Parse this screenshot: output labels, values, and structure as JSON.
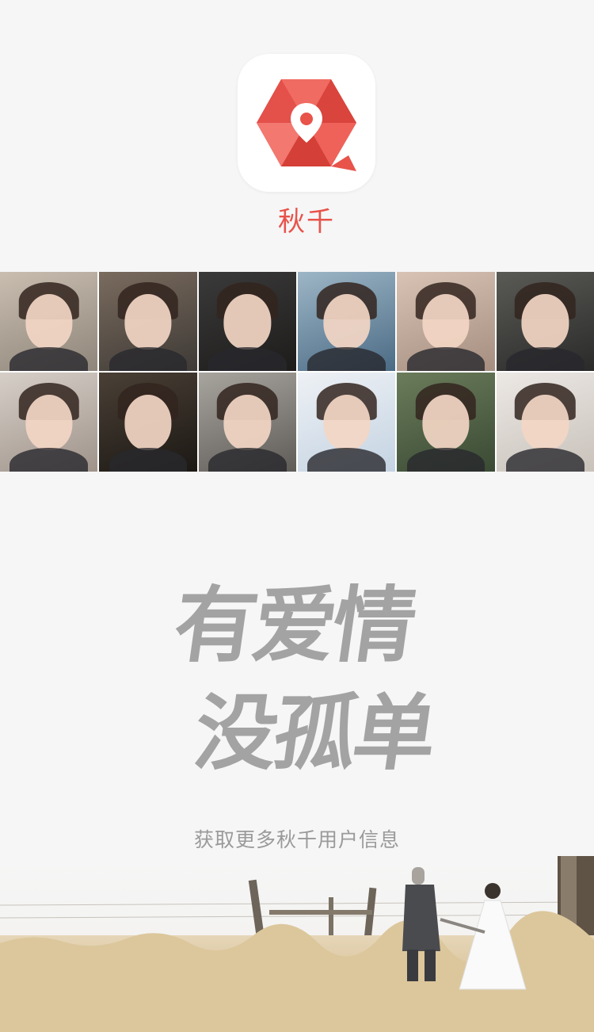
{
  "app": {
    "name": "秋千",
    "icon": "qiuqian-logo-icon",
    "brand_color": "#e8534a"
  },
  "user_grid": {
    "users": [
      {
        "name": "user-avatar",
        "bg": [
          "#c9beb0",
          "#8f857a"
        ]
      },
      {
        "name": "user-avatar",
        "bg": [
          "#7a6b5e",
          "#3e3a36"
        ]
      },
      {
        "name": "user-avatar",
        "bg": [
          "#3b3a3a",
          "#1d1c1b"
        ]
      },
      {
        "name": "user-avatar",
        "bg": [
          "#9db6c6",
          "#4b6b85"
        ]
      },
      {
        "name": "user-avatar",
        "bg": [
          "#d8c3b4",
          "#a58e80"
        ]
      },
      {
        "name": "user-avatar",
        "bg": [
          "#5a5a55",
          "#2a2a2a"
        ]
      },
      {
        "name": "user-avatar",
        "bg": [
          "#d6cfc8",
          "#9f938a"
        ]
      },
      {
        "name": "user-avatar",
        "bg": [
          "#4a4036",
          "#1c1814"
        ]
      },
      {
        "name": "user-avatar",
        "bg": [
          "#a8a49e",
          "#5f5c58"
        ]
      },
      {
        "name": "user-avatar",
        "bg": [
          "#eef1f5",
          "#c4d3e2"
        ]
      },
      {
        "name": "user-avatar",
        "bg": [
          "#6b7c5b",
          "#3a4a34"
        ]
      },
      {
        "name": "user-avatar",
        "bg": [
          "#ece8e4",
          "#c9c2bb"
        ]
      }
    ]
  },
  "slogan": {
    "line1": "有爱情",
    "line2": "没孤单"
  },
  "cta": {
    "text": "获取更多秋千用户信息"
  },
  "colors": {
    "background": "#f6f6f6",
    "slogan": "#a3a3a3",
    "cta_text": "#9a9a9a",
    "grass": "#d8c39a"
  }
}
